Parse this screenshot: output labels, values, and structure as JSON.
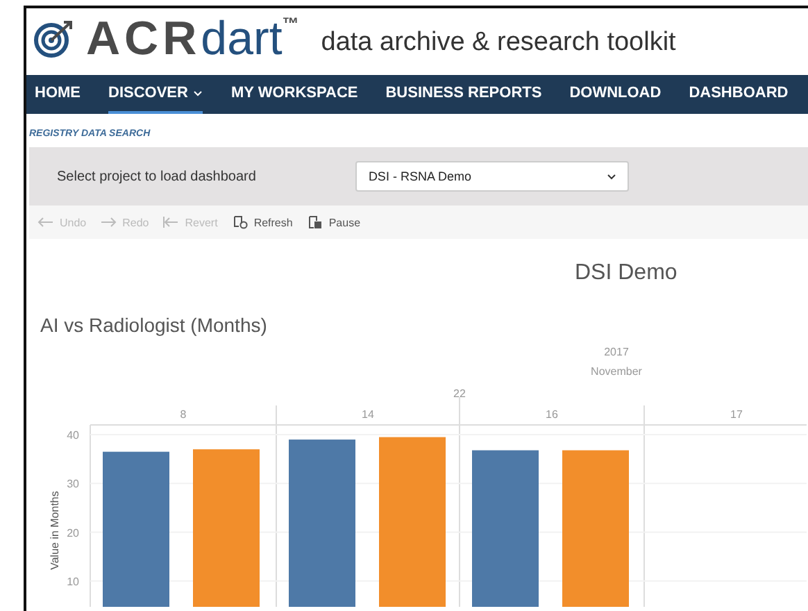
{
  "logo": {
    "mark": "ACR",
    "word": "dart",
    "trademark": "™",
    "tagline": "data archive & research toolkit"
  },
  "nav": [
    {
      "label": "HOME",
      "selected": false,
      "dropdown": false
    },
    {
      "label": "DISCOVER",
      "selected": true,
      "dropdown": true
    },
    {
      "label": "MY WORKSPACE",
      "selected": false,
      "dropdown": false
    },
    {
      "label": "BUSINESS REPORTS",
      "selected": false,
      "dropdown": false
    },
    {
      "label": "DOWNLOAD",
      "selected": false,
      "dropdown": false
    },
    {
      "label": "DASHBOARD",
      "selected": false,
      "dropdown": false
    }
  ],
  "section_title": "REGISTRY DATA SEARCH",
  "project_select": {
    "label": "Select project to load dashboard",
    "value": "DSI - RSNA Demo"
  },
  "toolbar": [
    {
      "kind": "undo",
      "label": "Undo",
      "disabled": true
    },
    {
      "kind": "redo",
      "label": "Redo",
      "disabled": true
    },
    {
      "kind": "revert",
      "label": "Revert",
      "disabled": true
    },
    {
      "kind": "refresh",
      "label": "Refresh",
      "disabled": false
    },
    {
      "kind": "pause",
      "label": "Pause",
      "disabled": false
    }
  ],
  "dashboard_title": "DSI Demo",
  "chart": {
    "headers": [
      "2017",
      "November",
      "22"
    ],
    "chart_data": {
      "type": "bar",
      "title": "AI vs Radiologist (Months)",
      "ylabel": "Value in Months",
      "categories": [
        "8",
        "14",
        "16",
        "17"
      ],
      "series": [
        {
          "color": "#4e79a7",
          "values": [
            36.5,
            39,
            36.8,
            null
          ]
        },
        {
          "color": "#f28e2b",
          "values": [
            37,
            39.5,
            36.8,
            null
          ]
        }
      ],
      "ylim": [
        4.7,
        42
      ],
      "yticks": [
        10,
        20,
        30,
        40
      ],
      "grid": true
    }
  }
}
